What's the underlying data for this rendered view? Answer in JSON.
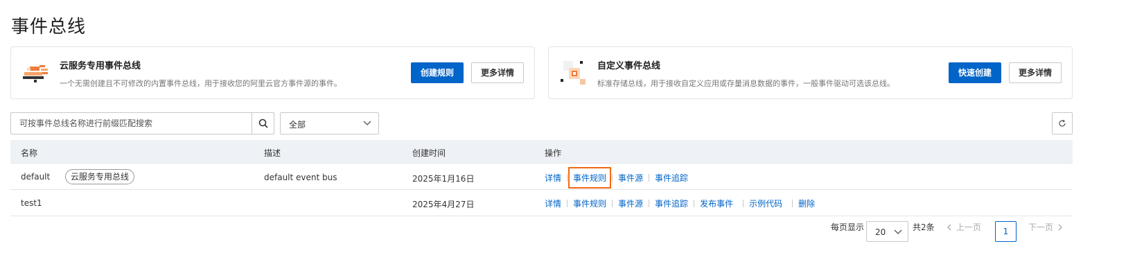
{
  "page": {
    "title": "事件总线"
  },
  "cards": {
    "cloud": {
      "title": "云服务专用事件总线",
      "description": "一个无需创建且不可修改的内置事件总线，用于接收您的阿里云官方事件源的事件。",
      "primary_label": "创建规则",
      "secondary_label": "更多详情"
    },
    "custom": {
      "title": "自定义事件总线",
      "description": "标准存储总线，用于接收自定义应用或存量消息数据的事件，一般事件驱动可选该总线。",
      "primary_label": "快速创建",
      "secondary_label": "更多详情"
    }
  },
  "toolbar": {
    "search_placeholder": "可按事件总线名称进行前缀匹配搜索",
    "filter_value": "全部"
  },
  "table": {
    "headers": {
      "name": "名称",
      "desc": "描述",
      "created": "创建时间",
      "ops": "操作"
    },
    "rows": [
      {
        "name": "default",
        "tag": "云服务专用总线",
        "desc": "default event bus",
        "created": "2025年1月16日",
        "ops": [
          "详情",
          "事件规则",
          "事件源",
          "事件追踪"
        ]
      },
      {
        "name": "test1",
        "tag": "",
        "desc": "",
        "created": "2025年4月27日",
        "ops": [
          "详情",
          "事件规则",
          "事件源",
          "事件追踪",
          "发布事件",
          "示例代码",
          "删除"
        ]
      }
    ]
  },
  "pagination": {
    "per_page_label": "每页显示",
    "per_page_value": "20",
    "total": "共2条",
    "prev": "上一页",
    "current": "1",
    "next": "下一页"
  },
  "colors": {
    "primary": "#0064c8",
    "highlight": "#f06a12",
    "header_bg": "#eef1f5"
  }
}
